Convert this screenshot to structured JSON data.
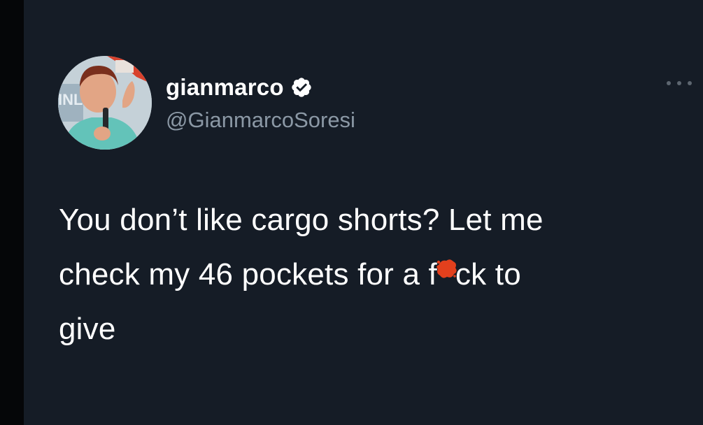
{
  "tweet": {
    "author": {
      "display_name": "gianmarco",
      "handle": "@GianmarcoSoresi",
      "verified": true,
      "avatar_icon": "avatar-photo-icon",
      "avatar_sign_text": "INL"
    },
    "more_icon": "more-options-icon",
    "text_segments": [
      "You don’t like cargo shorts? Let me\ncheck my 46 pockets for a f",
      "ck to\ngive"
    ],
    "censored_letter_icon": "red-scribble-censor-icon"
  },
  "colors": {
    "card_background": "#151c26",
    "left_bar": "#050608",
    "text_primary": "#ffffff",
    "text_secondary": "#8b98a5",
    "verified_badge": "#ffffff",
    "censor_mark": "#e2401d"
  }
}
